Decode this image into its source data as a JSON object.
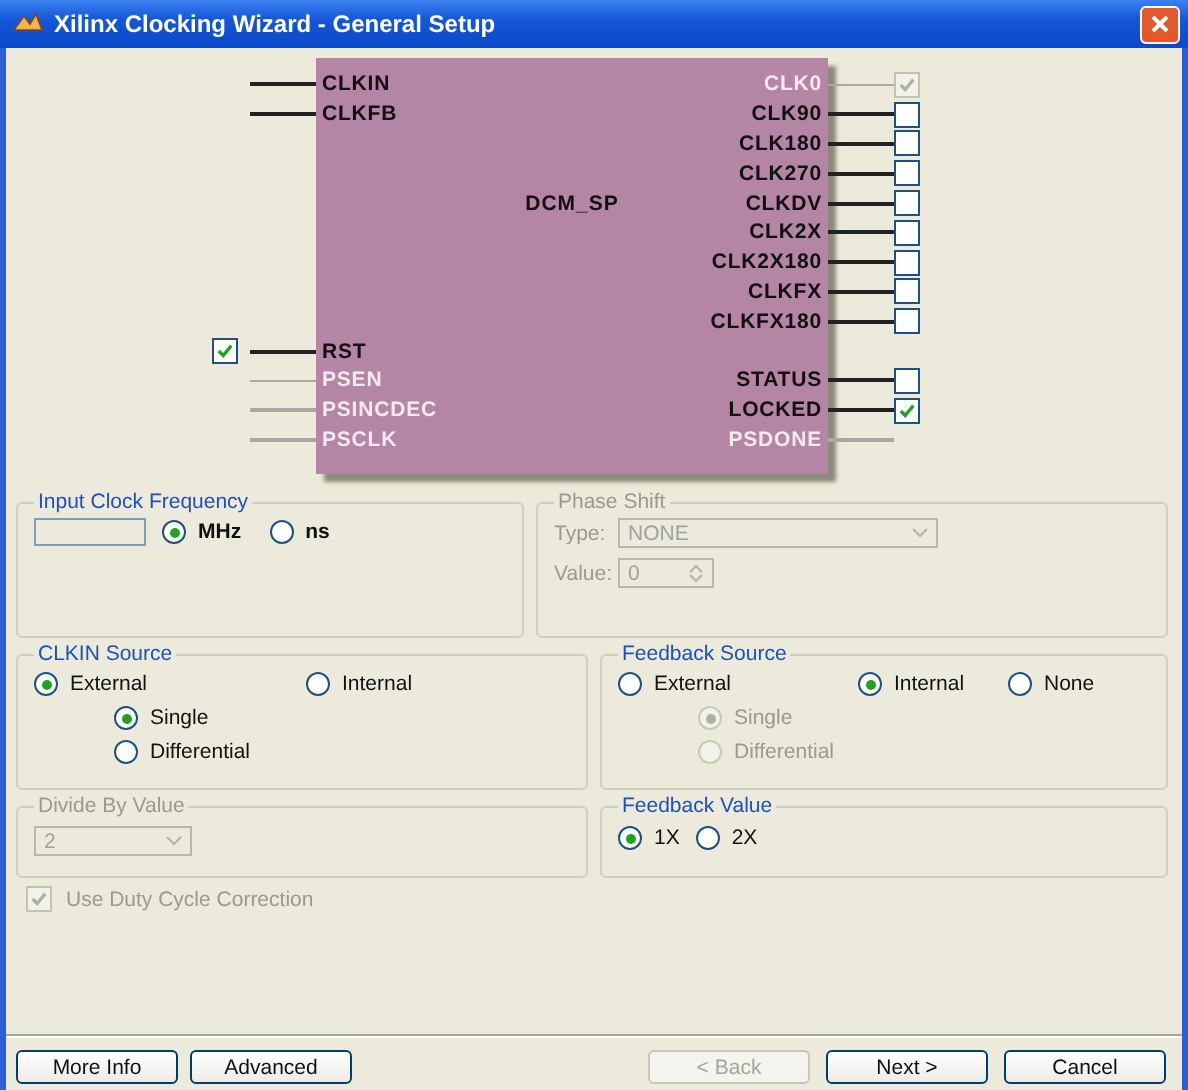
{
  "window": {
    "title": "Xilinx Clocking Wizard - General Setup"
  },
  "diagram": {
    "block_label": "DCM_SP",
    "rows": [
      {
        "left": {
          "label": "CLKIN",
          "disabled": false
        },
        "right": {
          "label": "CLK0",
          "disabled": true,
          "checkbox": {
            "checked": true,
            "disabled": true
          }
        }
      },
      {
        "left": {
          "label": "CLKFB",
          "disabled": false
        },
        "right": {
          "label": "CLK90",
          "disabled": false,
          "checkbox": {
            "checked": false,
            "disabled": false
          }
        }
      },
      {
        "right": {
          "label": "CLK180",
          "disabled": false,
          "checkbox": {
            "checked": false,
            "disabled": false
          }
        }
      },
      {
        "right": {
          "label": "CLK270",
          "disabled": false,
          "checkbox": {
            "checked": false,
            "disabled": false
          }
        }
      },
      {
        "right": {
          "label": "CLKDV",
          "disabled": false,
          "checkbox": {
            "checked": false,
            "disabled": false
          }
        }
      },
      {
        "right": {
          "label": "CLK2X",
          "disabled": false,
          "checkbox": {
            "checked": false,
            "disabled": false
          }
        }
      },
      {
        "right": {
          "label": "CLK2X180",
          "disabled": false,
          "checkbox": {
            "checked": false,
            "disabled": false
          }
        }
      },
      {
        "right": {
          "label": "CLKFX",
          "disabled": false,
          "checkbox": {
            "checked": false,
            "disabled": false
          }
        }
      },
      {
        "right": {
          "label": "CLKFX180",
          "disabled": false,
          "checkbox": {
            "checked": false,
            "disabled": false
          }
        }
      },
      {
        "left": {
          "label": "RST",
          "disabled": false,
          "checkbox": {
            "checked": true,
            "disabled": false
          }
        }
      },
      {
        "left": {
          "label": "PSEN",
          "disabled": true
        },
        "right": {
          "label": "STATUS",
          "disabled": false,
          "checkbox": {
            "checked": false,
            "disabled": false
          }
        }
      },
      {
        "left": {
          "label": "PSINCDEC",
          "disabled": true
        },
        "right": {
          "label": "LOCKED",
          "disabled": false,
          "checkbox": {
            "checked": true,
            "disabled": false
          }
        }
      },
      {
        "left": {
          "label": "PSCLK",
          "disabled": true
        },
        "right": {
          "label": "PSDONE",
          "disabled": true
        }
      }
    ]
  },
  "input_clock_frequency": {
    "title": "Input Clock Frequency",
    "disabled": false,
    "units": [
      {
        "label": "MHz",
        "selected": true
      },
      {
        "label": "ns",
        "selected": false
      }
    ]
  },
  "phase_shift": {
    "title": "Phase Shift",
    "disabled": true,
    "type_label": "Type:",
    "type_value": "NONE",
    "value_label": "Value:",
    "value": "0"
  },
  "clkin_source": {
    "title": "CLKIN Source",
    "disabled": false,
    "options": [
      {
        "label": "External",
        "selected": true,
        "disabled": false,
        "children": [
          {
            "label": "Single",
            "selected": true,
            "disabled": false
          },
          {
            "label": "Differential",
            "selected": false,
            "disabled": false
          }
        ]
      },
      {
        "label": "Internal",
        "selected": false,
        "disabled": false
      }
    ]
  },
  "feedback_source": {
    "title": "Feedback Source",
    "disabled": false,
    "options": [
      {
        "label": "External",
        "selected": false,
        "disabled": false,
        "children": [
          {
            "label": "Single",
            "selected": true,
            "disabled": true
          },
          {
            "label": "Differential",
            "selected": false,
            "disabled": true
          }
        ]
      },
      {
        "label": "Internal",
        "selected": true,
        "disabled": false
      },
      {
        "label": "None",
        "selected": false,
        "disabled": false
      }
    ]
  },
  "divide_by_value": {
    "title": "Divide By Value",
    "disabled": true,
    "value": "2"
  },
  "feedback_value": {
    "title": "Feedback Value",
    "disabled": false,
    "options": [
      {
        "label": "1X",
        "selected": true,
        "disabled": false
      },
      {
        "label": "2X",
        "selected": false,
        "disabled": false
      }
    ]
  },
  "duty_cycle_correction": {
    "label": "Use Duty Cycle Correction",
    "checked": true,
    "disabled": true
  },
  "buttons": {
    "left": [
      {
        "label": "More Info",
        "disabled": false
      },
      {
        "label": "Advanced",
        "disabled": false
      }
    ],
    "right": [
      {
        "label": "< Back",
        "disabled": true
      },
      {
        "label": "Next >",
        "disabled": false
      },
      {
        "label": "Cancel",
        "disabled": false
      }
    ]
  }
}
